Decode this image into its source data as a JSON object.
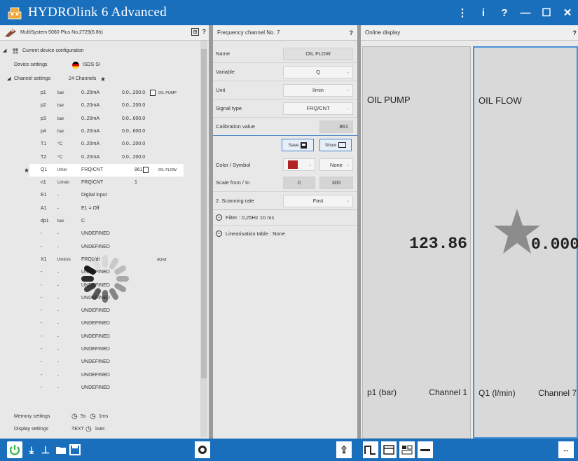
{
  "window": {
    "title": "HYDROlink 6 Advanced",
    "buttons": [
      "⋮",
      "i",
      "?",
      "—",
      "☐",
      "✕"
    ]
  },
  "left_panel": {
    "device_title": "MultiSystem 5060 Plus No.2729(6.8h)",
    "tree_root": "Current device configuration",
    "device_settings_label": "Device settings",
    "device_settings_value": "ISDS SI",
    "channel_settings_label": "Channel settings",
    "channel_settings_value": "24 Channels",
    "channels": [
      {
        "name": "p1",
        "unit": "bar",
        "signal": "0..20mA",
        "range": "0.0...200.0",
        "value": "",
        "label": "OIL PUMP",
        "save": true,
        "star": false,
        "selected": false
      },
      {
        "name": "p2",
        "unit": "bar",
        "signal": "0..20mA",
        "range": "0.0...200.0",
        "value": "",
        "label": "",
        "save": false,
        "star": false,
        "selected": false
      },
      {
        "name": "p3",
        "unit": "bar",
        "signal": "0..20mA",
        "range": "0.0...600.0",
        "value": "",
        "label": "",
        "save": false,
        "star": false,
        "selected": false
      },
      {
        "name": "p4",
        "unit": "bar",
        "signal": "0..20mA",
        "range": "0.0...600.0",
        "value": "",
        "label": "",
        "save": false,
        "star": false,
        "selected": false
      },
      {
        "name": "T1",
        "unit": "°C",
        "signal": "0..20mA",
        "range": "0.0...200.0",
        "value": "",
        "label": "",
        "save": false,
        "star": false,
        "selected": false
      },
      {
        "name": "T2",
        "unit": "°C",
        "signal": "0..20mA",
        "range": "0.0...200.0",
        "value": "",
        "label": "",
        "save": false,
        "star": false,
        "selected": false
      },
      {
        "name": "Q1",
        "unit": "l/min",
        "signal": "FRQ/CNT",
        "range": "",
        "value": "861",
        "label": "OIL FLOW",
        "save": true,
        "star": true,
        "selected": true
      },
      {
        "name": "n1",
        "unit": "U/min",
        "signal": "FRQ/CNT",
        "range": "",
        "value": "1",
        "label": "",
        "save": false,
        "star": false,
        "selected": false
      },
      {
        "name": "E1",
        "unit": "-",
        "signal": "Digital input",
        "range": "",
        "value": "",
        "label": "",
        "save": false,
        "star": false,
        "selected": false
      },
      {
        "name": "A1",
        "unit": "-",
        "signal": "E1 = Off",
        "range": "",
        "value": "",
        "label": "",
        "save": false,
        "star": false,
        "selected": false
      },
      {
        "name": "dp1",
        "unit": "bar",
        "signal": "C",
        "range": "",
        "value": "",
        "label": "",
        "save": false,
        "star": false,
        "selected": false
      },
      {
        "name": "-",
        "unit": "-",
        "signal": "UNDEFINED",
        "range": "",
        "value": "",
        "label": "",
        "save": false,
        "star": false,
        "selected": false
      },
      {
        "name": "-",
        "unit": "-",
        "signal": "UNDEFINED",
        "range": "",
        "value": "",
        "label": "",
        "save": false,
        "star": false,
        "selected": false
      },
      {
        "name": "X1",
        "unit": "l/min/s",
        "signal": "FRQ1/dt",
        "range": "",
        "value": "",
        "label": "dQ/dt",
        "save": false,
        "star": false,
        "selected": false
      },
      {
        "name": "-",
        "unit": "-",
        "signal": "UNDEFINED",
        "range": "",
        "value": "",
        "label": "",
        "save": false,
        "star": false,
        "selected": false
      },
      {
        "name": "-",
        "unit": "-",
        "signal": "UNDEFINED",
        "range": "",
        "value": "",
        "label": "",
        "save": false,
        "star": false,
        "selected": false
      },
      {
        "name": "-",
        "unit": "-",
        "signal": "UNDEFINED",
        "range": "",
        "value": "",
        "label": "",
        "save": false,
        "star": false,
        "selected": false
      },
      {
        "name": "-",
        "unit": "-",
        "signal": "UNDEFINED",
        "range": "",
        "value": "",
        "label": "",
        "save": false,
        "star": false,
        "selected": false
      },
      {
        "name": "-",
        "unit": "-",
        "signal": "UNDEFINED",
        "range": "",
        "value": "",
        "label": "",
        "save": false,
        "star": false,
        "selected": false
      },
      {
        "name": "-",
        "unit": "-",
        "signal": "UNDEFINED",
        "range": "",
        "value": "",
        "label": "",
        "save": false,
        "star": false,
        "selected": false
      },
      {
        "name": "-",
        "unit": "-",
        "signal": "UNDEFINED",
        "range": "",
        "value": "",
        "label": "",
        "save": false,
        "star": false,
        "selected": false
      },
      {
        "name": "-",
        "unit": "-",
        "signal": "UNDEFINED",
        "range": "",
        "value": "",
        "label": "",
        "save": false,
        "star": false,
        "selected": false
      },
      {
        "name": "-",
        "unit": "-",
        "signal": "UNDEFINED",
        "range": "",
        "value": "",
        "label": "",
        "save": false,
        "star": false,
        "selected": false
      },
      {
        "name": "-",
        "unit": "-",
        "signal": "UNDEFINED",
        "range": "",
        "value": "",
        "label": "",
        "save": false,
        "star": false,
        "selected": false
      }
    ],
    "memory_settings_label": "Memory settings",
    "memory_settings_value1": "5s",
    "memory_settings_value2": "1ms",
    "display_settings_label": "Display settings",
    "display_settings_value1": "TEXT",
    "display_settings_value2": "1sec"
  },
  "mid_panel": {
    "header": "Frequency channel  No.  7",
    "help": "?",
    "name_label": "Name",
    "name_value": "OIL FLOW",
    "variable_label": "Variable",
    "variable_value": "Q",
    "unit_label": "Unit",
    "unit_value": "l/min",
    "signal_label": "Signal type",
    "signal_value": "FRQ/CNT",
    "calib_label": "Calibration value",
    "calib_value": "861",
    "save_label": "Save",
    "show_label": "Show",
    "color_label": "Color / Symbol",
    "color_swatch": "#b22222",
    "symbol_value": "None",
    "scale_label": "Scale from / to",
    "scale_from": "0",
    "scale_to": "300",
    "scan_label": "2. Scanning rate",
    "scan_value": "Fast",
    "filter_label": "Filter  :  0,25Hz  10 ms",
    "lin_label": "Linearisation table  :  None"
  },
  "right_panel": {
    "header": "Online display",
    "help": "?",
    "displays": [
      {
        "name": "OIL PUMP",
        "value": "123.86",
        "unit": "p1 (bar)",
        "channel": "Channel 1"
      },
      {
        "name": "OIL FLOW",
        "value": "0.000",
        "unit": "Q1 (l/min)",
        "channel": "Channel 7"
      }
    ]
  },
  "colors": {
    "brand": "#1a6fbd",
    "power": "#39b54a",
    "selected_border": "#4a90d9"
  }
}
